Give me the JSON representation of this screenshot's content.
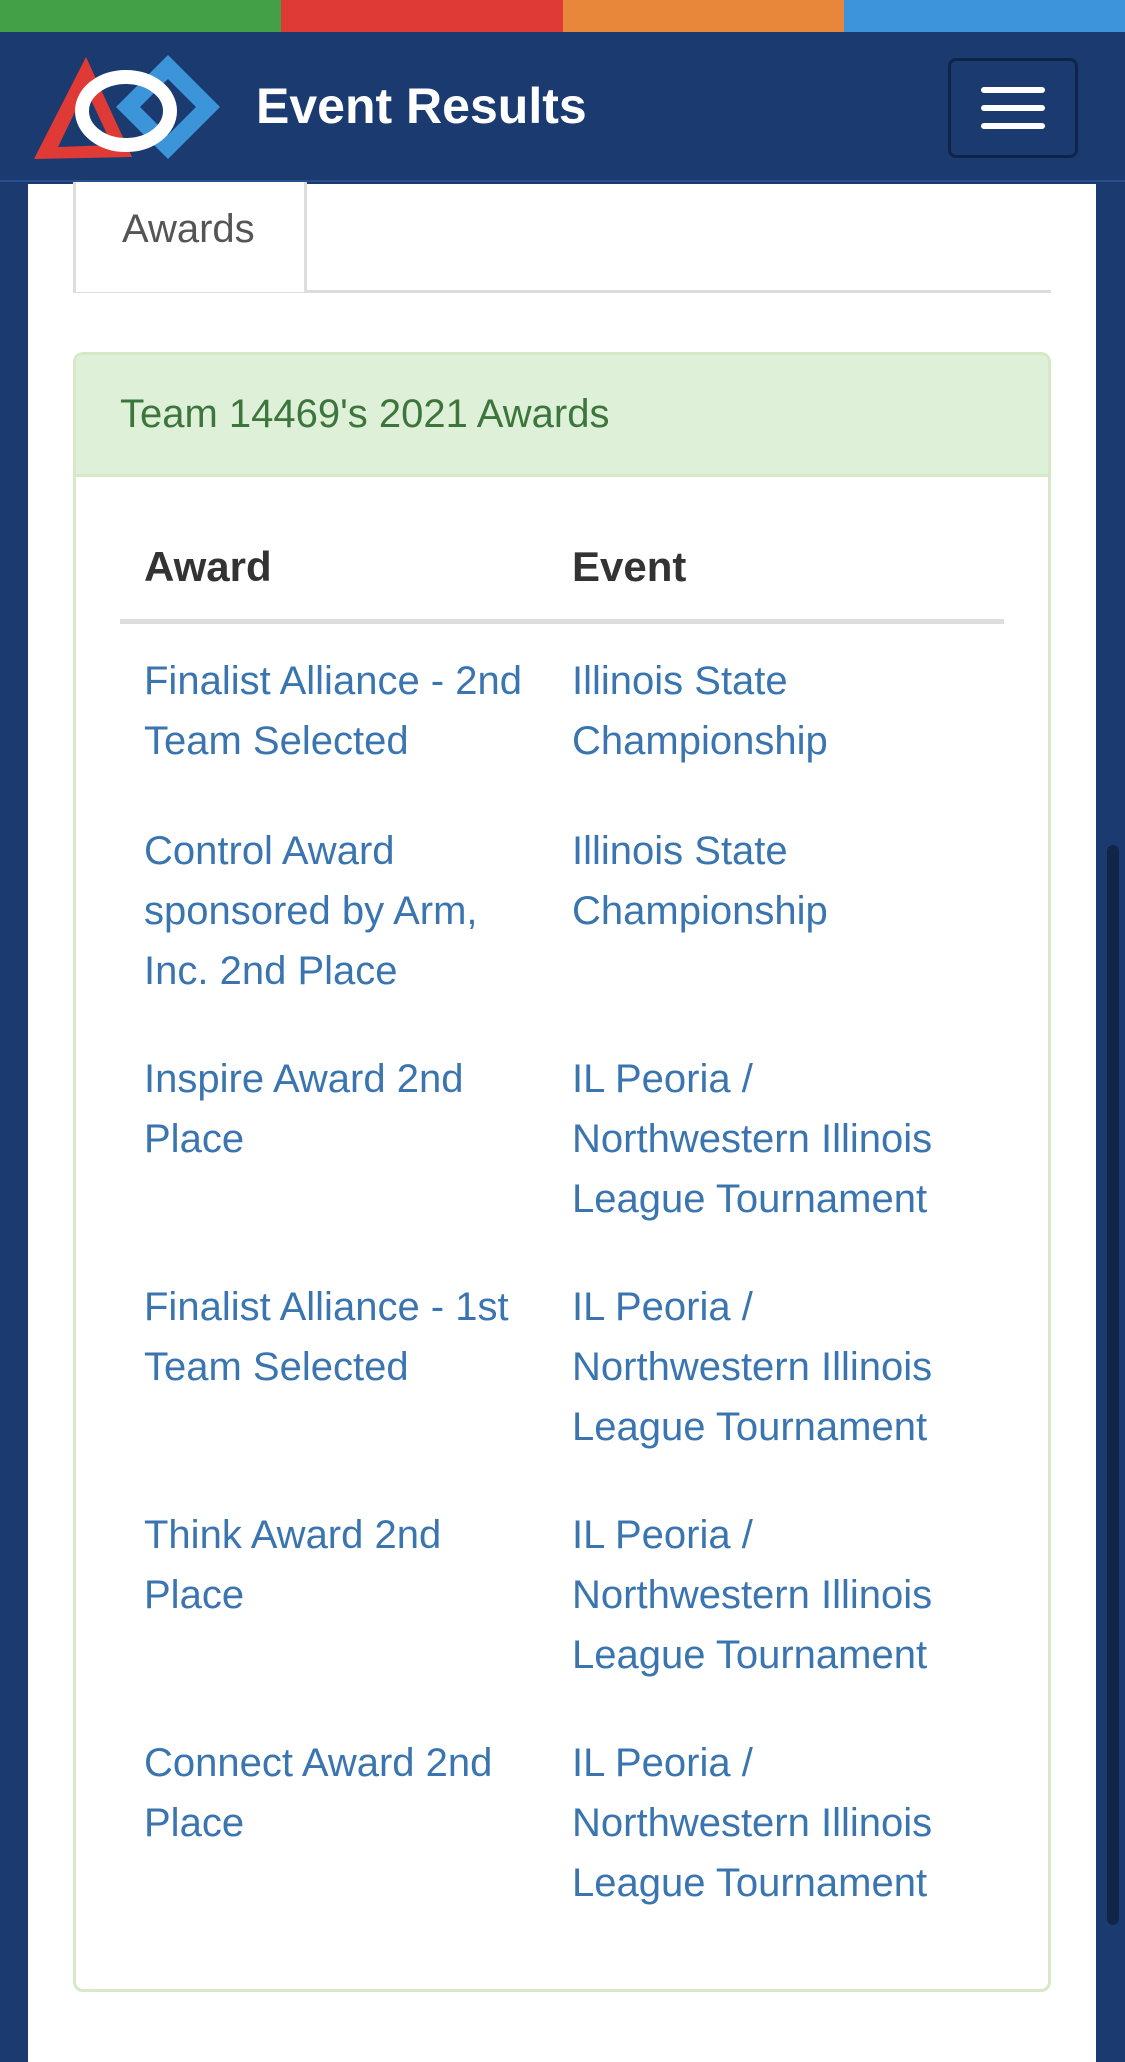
{
  "colors": {
    "strip": [
      "#43a047",
      "#e03a36",
      "#e8873a",
      "#3d95d9"
    ],
    "navbar_bg": "#1b3a70",
    "link": "#3a75b0",
    "panel_heading_bg": "#dff0d8",
    "panel_heading_text": "#3c763d"
  },
  "navbar": {
    "title": "Event Results",
    "logo_icon": "first-logo-icon",
    "menu_icon": "hamburger-menu-icon"
  },
  "tabs": [
    {
      "label": "Awards",
      "active": true
    }
  ],
  "panel": {
    "title": "Team 14469's 2021 Awards"
  },
  "table": {
    "headers": [
      "Award",
      "Event"
    ],
    "rows": [
      {
        "award": "Finalist Alliance - 2nd Team Selected",
        "event": "Illinois State Championship"
      },
      {
        "award": "Control Award sponsored by Arm, Inc. 2nd Place",
        "event": "Illinois State Championship"
      },
      {
        "award": "Inspire Award 2nd Place",
        "event": "IL Peoria / Northwestern Illinois League Tournament"
      },
      {
        "award": "Finalist Alliance - 1st Team Selected",
        "event": "IL Peoria / Northwestern Illinois League Tournament"
      },
      {
        "award": "Think Award 2nd Place",
        "event": "IL Peoria / Northwestern Illinois League Tournament"
      },
      {
        "award": "Connect Award 2nd Place",
        "event": "IL Peoria / Northwestern Illinois League Tournament"
      }
    ]
  }
}
